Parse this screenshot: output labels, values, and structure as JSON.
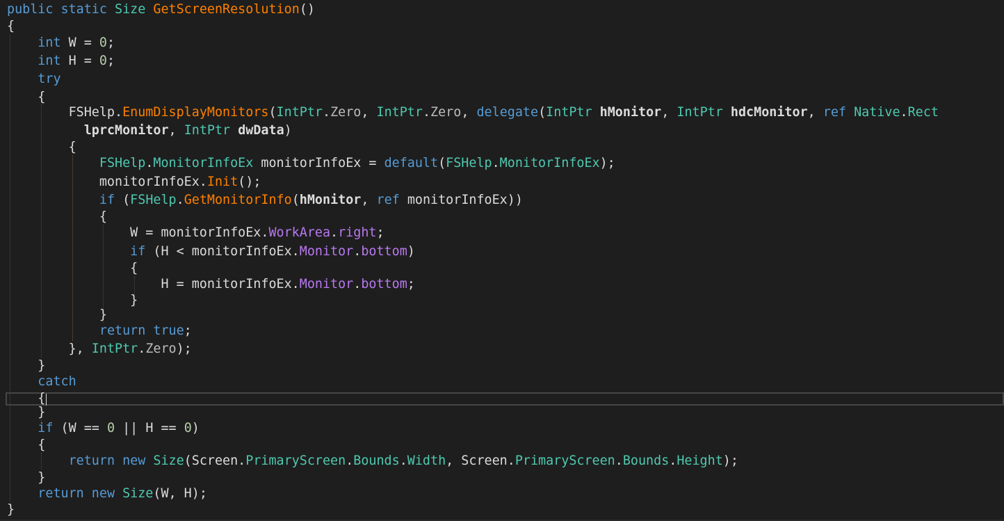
{
  "editor": {
    "background": "#1e1e1e",
    "lines": [
      [
        [
          "kw",
          "public static "
        ],
        [
          "type",
          "Size "
        ],
        [
          "method",
          "GetScreenResolution"
        ],
        [
          "plain",
          "()"
        ]
      ],
      [
        [
          "plain",
          "{"
        ]
      ],
      [
        [
          "plain",
          "    "
        ],
        [
          "kw",
          "int "
        ],
        [
          "plain",
          "W = "
        ],
        [
          "num",
          "0"
        ],
        [
          "plain",
          ";"
        ]
      ],
      [
        [
          "plain",
          "    "
        ],
        [
          "kw",
          "int "
        ],
        [
          "plain",
          "H = "
        ],
        [
          "num",
          "0"
        ],
        [
          "plain",
          ";"
        ]
      ],
      [
        [
          "plain",
          "    "
        ],
        [
          "kw",
          "try"
        ]
      ],
      [
        [
          "plain",
          "    {"
        ]
      ],
      [
        [
          "plain",
          "        FSHelp."
        ],
        [
          "method",
          "EnumDisplayMonitors"
        ],
        [
          "plain",
          "("
        ],
        [
          "type",
          "IntPtr"
        ],
        [
          "plain",
          "."
        ],
        [
          "field",
          "Zero"
        ],
        [
          "plain",
          ", "
        ],
        [
          "type",
          "IntPtr"
        ],
        [
          "plain",
          "."
        ],
        [
          "field",
          "Zero"
        ],
        [
          "plain",
          ", "
        ],
        [
          "kw",
          "delegate"
        ],
        [
          "plain",
          "("
        ],
        [
          "type",
          "IntPtr "
        ],
        [
          "param",
          "hMonitor"
        ],
        [
          "plain",
          ", "
        ],
        [
          "type",
          "IntPtr "
        ],
        [
          "param",
          "hdcMonitor"
        ],
        [
          "plain",
          ", "
        ],
        [
          "kw",
          "ref "
        ],
        [
          "type",
          "Native"
        ],
        [
          "plain",
          "."
        ],
        [
          "type",
          "Rect"
        ]
      ],
      [
        [
          "plain",
          "          "
        ],
        [
          "param",
          "lprcMonitor"
        ],
        [
          "plain",
          ", "
        ],
        [
          "type",
          "IntPtr "
        ],
        [
          "param",
          "dwData"
        ],
        [
          "plain",
          ")"
        ]
      ],
      [
        [
          "plain",
          "        {"
        ]
      ],
      [
        [
          "plain",
          "            "
        ],
        [
          "type",
          "FSHelp"
        ],
        [
          "plain",
          "."
        ],
        [
          "type",
          "MonitorInfoEx "
        ],
        [
          "plain",
          "monitorInfoEx = "
        ],
        [
          "kw",
          "default"
        ],
        [
          "plain",
          "("
        ],
        [
          "type",
          "FSHelp"
        ],
        [
          "plain",
          "."
        ],
        [
          "type",
          "MonitorInfoEx"
        ],
        [
          "plain",
          ");"
        ]
      ],
      [
        [
          "plain",
          "            monitorInfoEx."
        ],
        [
          "method",
          "Init"
        ],
        [
          "plain",
          "();"
        ]
      ],
      [
        [
          "plain",
          "            "
        ],
        [
          "kw",
          "if "
        ],
        [
          "plain",
          "("
        ],
        [
          "type",
          "FSHelp"
        ],
        [
          "plain",
          "."
        ],
        [
          "method",
          "GetMonitorInfo"
        ],
        [
          "plain",
          "("
        ],
        [
          "param",
          "hMonitor"
        ],
        [
          "plain",
          ", "
        ],
        [
          "kw",
          "ref "
        ],
        [
          "plain",
          "monitorInfoEx))"
        ]
      ],
      [
        [
          "plain",
          "            {"
        ]
      ],
      [
        [
          "plain",
          "                W = monitorInfoEx."
        ],
        [
          "prop",
          "WorkArea"
        ],
        [
          "plain",
          "."
        ],
        [
          "prop",
          "right"
        ],
        [
          "plain",
          ";"
        ]
      ],
      [
        [
          "plain",
          "                "
        ],
        [
          "kw",
          "if "
        ],
        [
          "plain",
          "(H < monitorInfoEx."
        ],
        [
          "prop",
          "Monitor"
        ],
        [
          "plain",
          "."
        ],
        [
          "prop",
          "bottom"
        ],
        [
          "plain",
          ")"
        ]
      ],
      [
        [
          "plain",
          "                {"
        ]
      ],
      [
        [
          "plain",
          "                    H = monitorInfoEx."
        ],
        [
          "prop",
          "Monitor"
        ],
        [
          "plain",
          "."
        ],
        [
          "prop",
          "bottom"
        ],
        [
          "plain",
          ";"
        ]
      ],
      [
        [
          "plain",
          "                }"
        ]
      ],
      [
        [
          "plain",
          "            }"
        ]
      ],
      [
        [
          "plain",
          "            "
        ],
        [
          "kw",
          "return true"
        ],
        [
          "plain",
          ";"
        ]
      ],
      [
        [
          "plain",
          "        }, "
        ],
        [
          "type",
          "IntPtr"
        ],
        [
          "plain",
          "."
        ],
        [
          "field",
          "Zero"
        ],
        [
          "plain",
          ");"
        ]
      ],
      [
        [
          "plain",
          "    }"
        ]
      ],
      [
        [
          "plain",
          "    "
        ],
        [
          "kw",
          "catch"
        ]
      ],
      [
        [
          "plain",
          "    {"
        ]
      ],
      [
        [
          "plain",
          "    }"
        ]
      ],
      [
        [
          "plain",
          "    "
        ],
        [
          "kw",
          "if "
        ],
        [
          "plain",
          "(W == "
        ],
        [
          "num",
          "0 "
        ],
        [
          "plain",
          "|| H == "
        ],
        [
          "num",
          "0"
        ],
        [
          "plain",
          ")"
        ]
      ],
      [
        [
          "plain",
          "    {"
        ]
      ],
      [
        [
          "plain",
          "        "
        ],
        [
          "kw",
          "return new "
        ],
        [
          "type",
          "Size"
        ],
        [
          "plain",
          "(Screen."
        ],
        [
          "type",
          "PrimaryScreen"
        ],
        [
          "plain",
          "."
        ],
        [
          "type",
          "Bounds"
        ],
        [
          "plain",
          "."
        ],
        [
          "type",
          "Width"
        ],
        [
          "plain",
          ", Screen."
        ],
        [
          "type",
          "PrimaryScreen"
        ],
        [
          "plain",
          "."
        ],
        [
          "type",
          "Bounds"
        ],
        [
          "plain",
          "."
        ],
        [
          "type",
          "Height"
        ],
        [
          "plain",
          ");"
        ]
      ],
      [
        [
          "plain",
          "    }"
        ]
      ],
      [
        [
          "plain",
          "    "
        ],
        [
          "kw",
          "return new "
        ],
        [
          "type",
          "Size"
        ],
        [
          "plain",
          "(W, H);"
        ]
      ],
      [
        [
          "plain",
          "}"
        ]
      ]
    ]
  }
}
